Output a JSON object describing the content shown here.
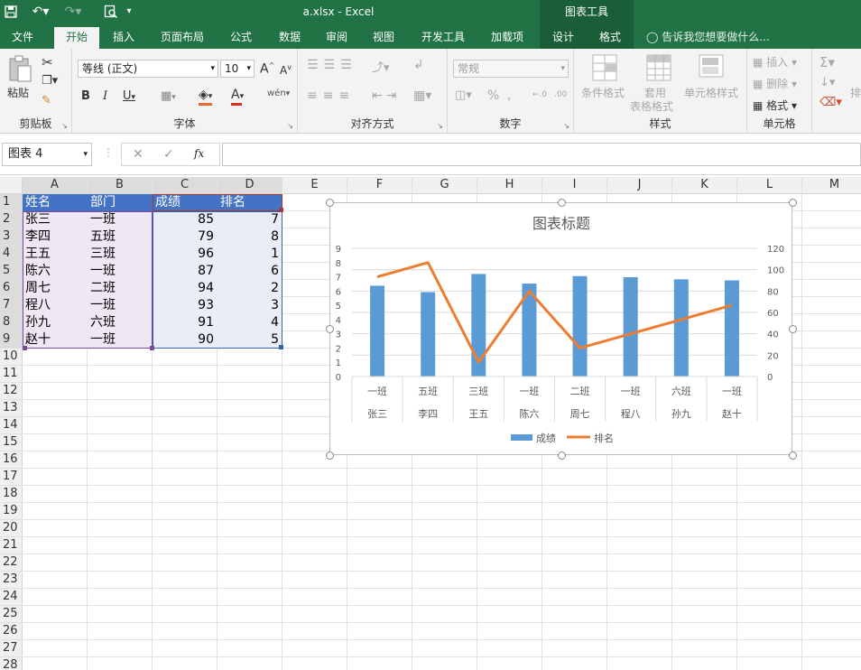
{
  "window": {
    "title": "a.xlsx - Excel",
    "chart_tools_label": "图表工具"
  },
  "tabs": [
    {
      "label": "文件"
    },
    {
      "label": "开始"
    },
    {
      "label": "插入"
    },
    {
      "label": "页面布局"
    },
    {
      "label": "公式"
    },
    {
      "label": "数据"
    },
    {
      "label": "审阅"
    },
    {
      "label": "视图"
    },
    {
      "label": "开发工具"
    },
    {
      "label": "加载项"
    },
    {
      "label": "设计"
    },
    {
      "label": "格式"
    }
  ],
  "tell_me": "告诉我您想要做什么...",
  "ribbon": {
    "clipboard": {
      "label": "剪贴板",
      "paste": "粘贴"
    },
    "font": {
      "label": "字体",
      "name": "等线 (正文)",
      "size": "10",
      "bold": "B",
      "italic": "I",
      "underline": "U",
      "grow": "A",
      "shrink": "A"
    },
    "alignment": {
      "label": "对齐方式"
    },
    "number": {
      "label": "数字",
      "format": "常规"
    },
    "styles": {
      "label": "样式",
      "conditional": "条件格式",
      "table_format_1": "套用",
      "table_format_2": "表格格式",
      "cell_styles": "单元格样式"
    },
    "cells": {
      "label": "单元格",
      "insert": "插入",
      "delete": "删除",
      "format": "格式"
    },
    "editing": {
      "sort": "排"
    }
  },
  "formula_bar": {
    "name_box": "图表 4",
    "fx": "fx",
    "formula": ""
  },
  "sheet": {
    "columns": [
      "A",
      "B",
      "C",
      "D",
      "E",
      "F",
      "G",
      "H",
      "I",
      "J",
      "K",
      "L",
      "M"
    ],
    "rows": [
      "1",
      "2",
      "3",
      "4",
      "5",
      "6",
      "7",
      "8",
      "9",
      "10",
      "11",
      "12",
      "13",
      "14",
      "15",
      "16",
      "17",
      "18",
      "19",
      "20",
      "21",
      "22",
      "23",
      "24",
      "25",
      "26",
      "27",
      "28"
    ],
    "headers": [
      "姓名",
      "部门",
      "成绩",
      "排名"
    ],
    "data": [
      [
        "张三",
        "一班",
        "85",
        "7"
      ],
      [
        "李四",
        "五班",
        "79",
        "8"
      ],
      [
        "王五",
        "三班",
        "96",
        "1"
      ],
      [
        "陈六",
        "一班",
        "87",
        "6"
      ],
      [
        "周七",
        "二班",
        "94",
        "2"
      ],
      [
        "程八",
        "一班",
        "93",
        "3"
      ],
      [
        "孙九",
        "六班",
        "91",
        "4"
      ],
      [
        "赵十",
        "一班",
        "90",
        "5"
      ]
    ]
  },
  "colors": {
    "excel_green": "#217346",
    "bar": "#5b9bd5",
    "line": "#ed7d31",
    "header_fill": "#4472c4"
  },
  "chart_data": {
    "type": "bar",
    "title": "图表标题",
    "categories": [
      [
        "一班",
        "张三"
      ],
      [
        "五班",
        "李四"
      ],
      [
        "三班",
        "王五"
      ],
      [
        "一班",
        "陈六"
      ],
      [
        "二班",
        "周七"
      ],
      [
        "一班",
        "程八"
      ],
      [
        "六班",
        "孙九"
      ],
      [
        "一班",
        "赵十"
      ]
    ],
    "series": [
      {
        "name": "成绩",
        "type": "bar",
        "axis": "right",
        "values": [
          85,
          79,
          96,
          87,
          94,
          93,
          91,
          90
        ]
      },
      {
        "name": "排名",
        "type": "line",
        "axis": "left",
        "values": [
          7,
          8,
          1,
          6,
          2,
          3,
          4,
          5
        ]
      }
    ],
    "y_left": {
      "range": [
        0,
        9
      ],
      "ticks": [
        "0",
        "1",
        "2",
        "3",
        "4",
        "5",
        "6",
        "7",
        "8",
        "9"
      ]
    },
    "y_right": {
      "range": [
        0,
        120
      ],
      "ticks": [
        "0",
        "20",
        "40",
        "60",
        "80",
        "100",
        "120"
      ]
    },
    "legend": "bottom",
    "grid": true
  }
}
